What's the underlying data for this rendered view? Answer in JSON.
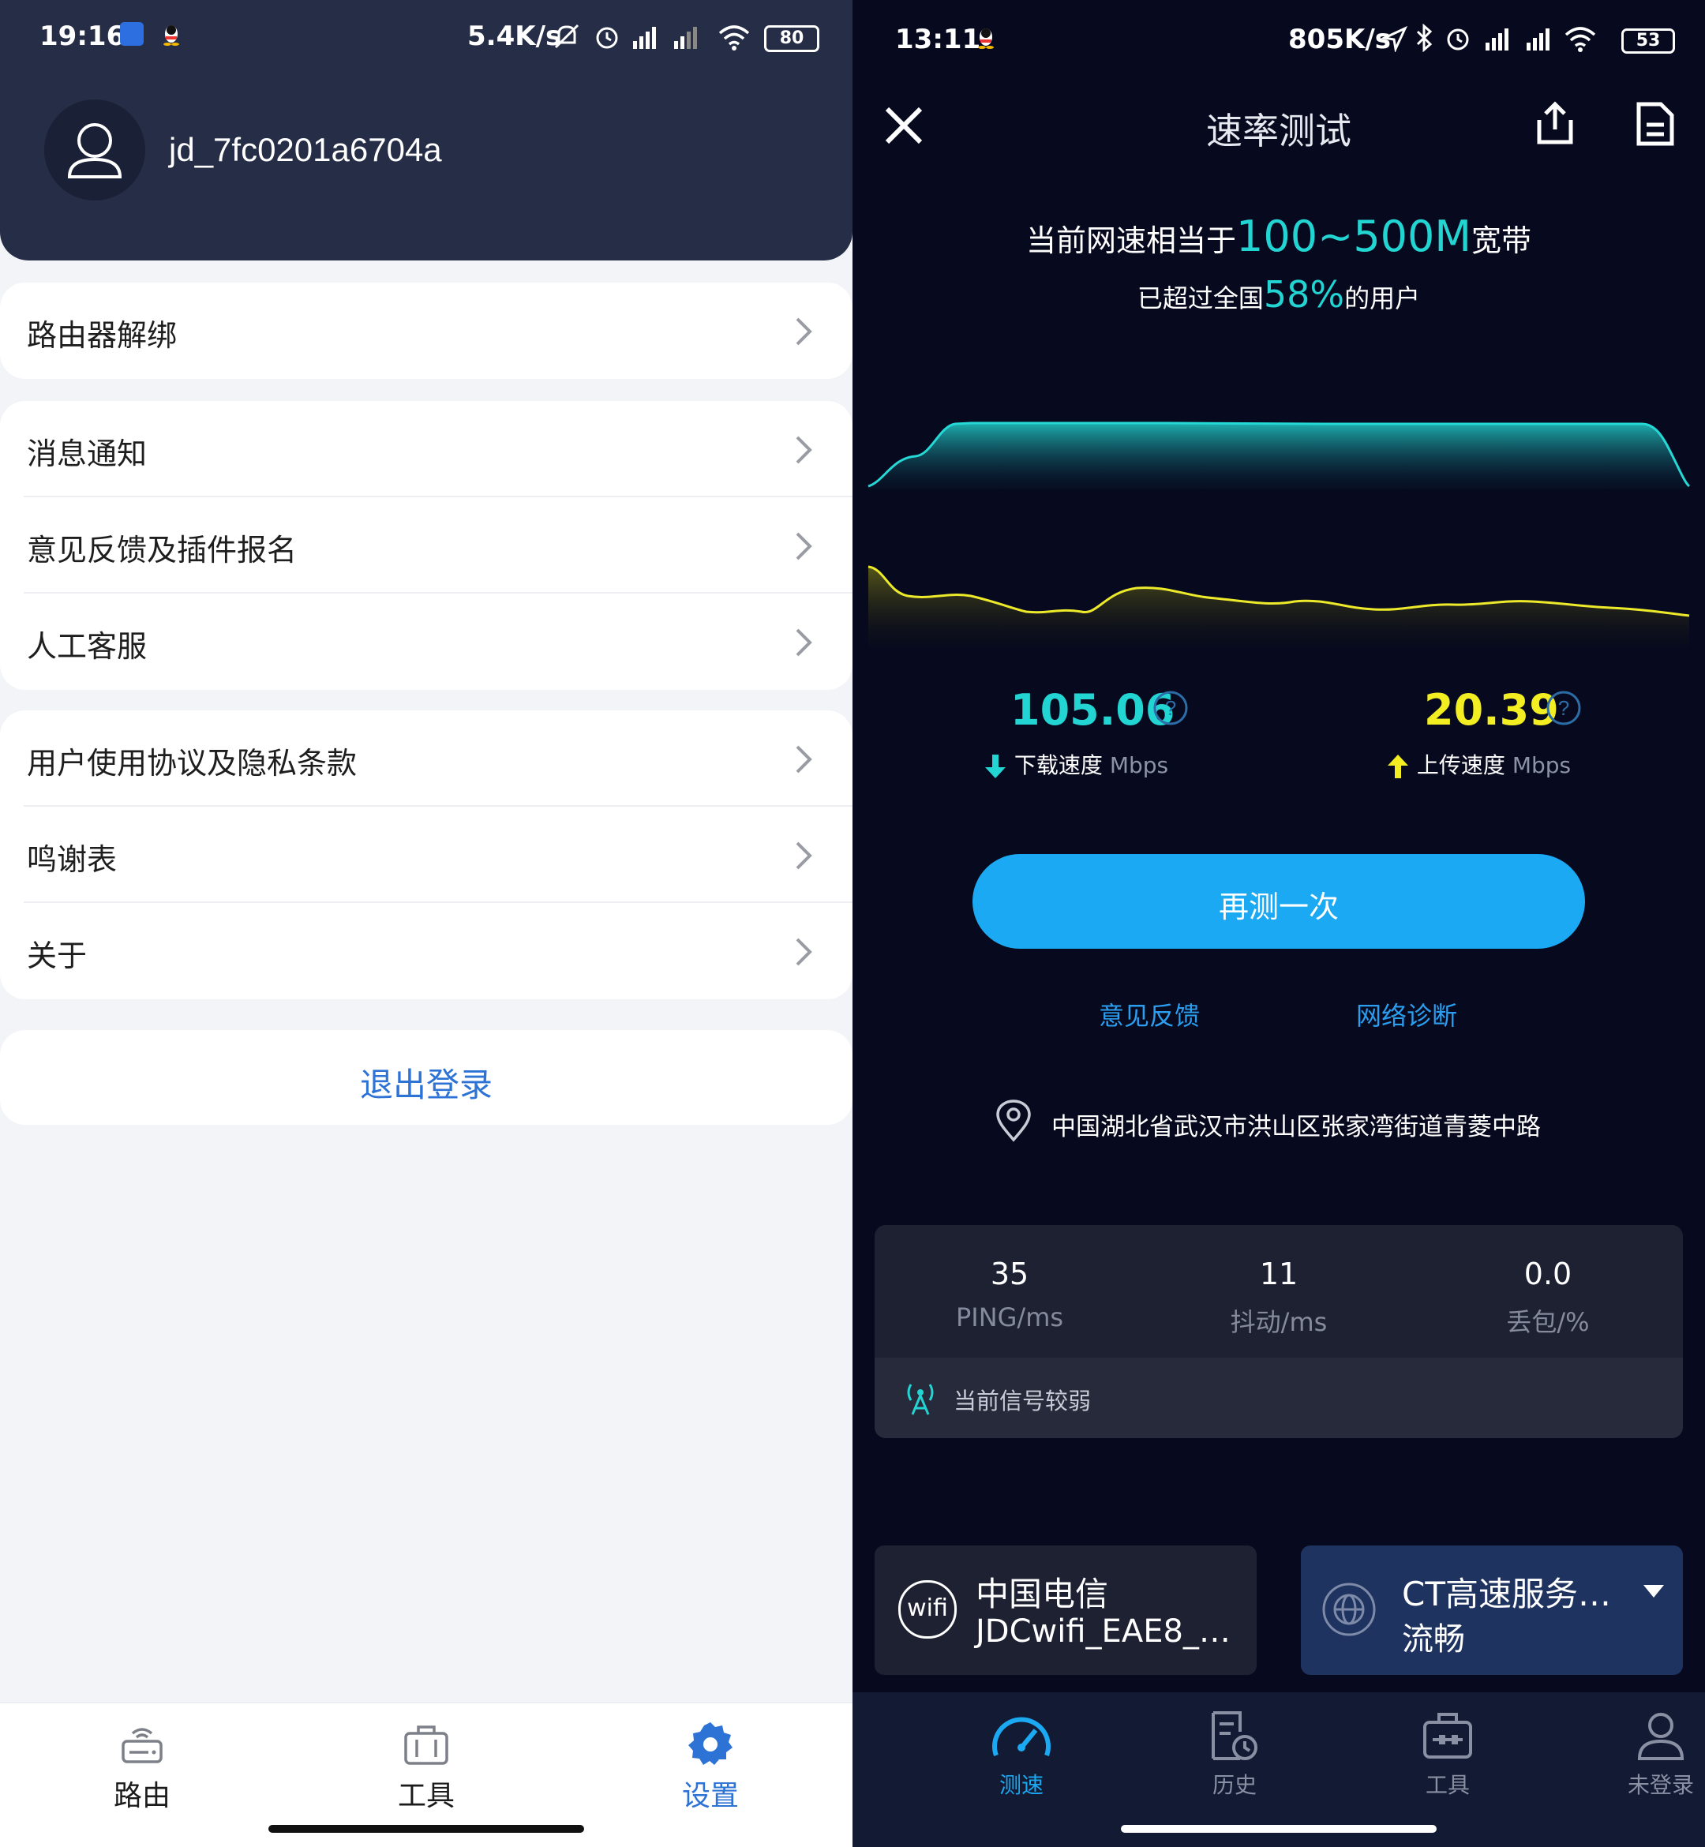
{
  "left": {
    "status_bar": {
      "time": "19:16",
      "net_speed": "5.4K/s",
      "battery": "80"
    },
    "profile": {
      "username": "jd_7fc0201a6704a",
      "avatar_icon": "user-icon"
    },
    "groups": [
      {
        "items": [
          {
            "label": "路由器解绑"
          }
        ]
      },
      {
        "items": [
          {
            "label": "消息通知"
          },
          {
            "label": "意见反馈及插件报名"
          },
          {
            "label": "人工客服"
          }
        ]
      },
      {
        "items": [
          {
            "label": "用户使用协议及隐私条款"
          },
          {
            "label": "鸣谢表"
          },
          {
            "label": "关于"
          }
        ]
      }
    ],
    "logout_label": "退出登录",
    "tabs": [
      {
        "label": "路由",
        "icon": "router-icon",
        "active": false
      },
      {
        "label": "工具",
        "icon": "toolbox-icon",
        "active": false
      },
      {
        "label": "设置",
        "icon": "gear-icon",
        "active": true
      }
    ],
    "colors": {
      "header": "#262d46",
      "accent": "#2d73d6",
      "background": "#f3f4f8"
    }
  },
  "right": {
    "status_bar": {
      "time": "13:11",
      "net_speed": "805K/s",
      "battery": "53"
    },
    "title": "速率测试",
    "summary": {
      "prefix": "当前网速相当于",
      "bandwidth": "100~500M",
      "suffix": "宽带",
      "beat_prefix": "已超过全国",
      "beat_percent": "58%",
      "beat_suffix": "的用户"
    },
    "download": {
      "value": "105.06",
      "label": "下载速度",
      "unit": "Mbps"
    },
    "upload": {
      "value": "20.39",
      "label": "上传速度",
      "unit": "Mbps"
    },
    "retest_label": "再测一次",
    "feedback_label": "意见反馈",
    "diagnose_label": "网络诊断",
    "location": "中国湖北省武汉市洪山区张家湾街道青菱中路",
    "stats": [
      {
        "value": "35",
        "label": "PING/ms"
      },
      {
        "value": "11",
        "label": "抖动/ms"
      },
      {
        "value": "0.0",
        "label": "丢包/%"
      }
    ],
    "signal_note": "当前信号较弱",
    "network": {
      "isp": "中国电信",
      "ssid": "JDCwifi_EAE8_…",
      "icon_text": "wifi"
    },
    "server": {
      "name": "CT高速服务…",
      "status": "流畅"
    },
    "tabs": [
      {
        "label": "测速",
        "icon": "speedometer-icon",
        "active": true
      },
      {
        "label": "历史",
        "icon": "history-icon",
        "active": false
      },
      {
        "label": "工具",
        "icon": "toolbox-icon",
        "active": false
      },
      {
        "label": "未登录",
        "icon": "user-icon",
        "active": false
      }
    ],
    "colors": {
      "download": "#22d4d2",
      "upload": "#f2ee22",
      "button": "#1aa9f2",
      "link": "#2b9ef0"
    }
  }
}
